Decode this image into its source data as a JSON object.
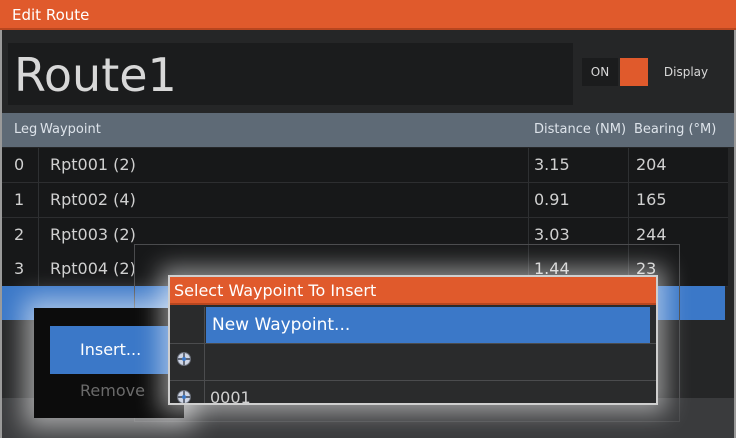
{
  "window": {
    "title": "Edit Route"
  },
  "route": {
    "name": "Route1",
    "toggle_state": "ON",
    "toggle_on": true,
    "display_label": "Display"
  },
  "table": {
    "columns": [
      "Leg",
      "Waypoint",
      "Distance (NM)",
      "Bearing (°M)"
    ],
    "rows": [
      {
        "leg": "0",
        "waypoint": "Rpt001 (2)",
        "distance": "3.15",
        "bearing": "204"
      },
      {
        "leg": "1",
        "waypoint": "Rpt002 (4)",
        "distance": "0.91",
        "bearing": "165"
      },
      {
        "leg": "2",
        "waypoint": "Rpt003 (2)",
        "distance": "3.03",
        "bearing": "244"
      },
      {
        "leg": "3",
        "waypoint": "Rpt004 (2)",
        "distance": "1.44",
        "bearing": "23"
      }
    ]
  },
  "context_menu": {
    "insert": "Insert...",
    "remove": "Remove"
  },
  "dialog": {
    "title": "Select Waypoint To Insert",
    "new_waypoint": "New Waypoint...",
    "items": [
      "",
      "0001"
    ]
  },
  "colors": {
    "accent": "#e05a2c",
    "selection": "#3b78c8",
    "header": "#5e6a76"
  }
}
